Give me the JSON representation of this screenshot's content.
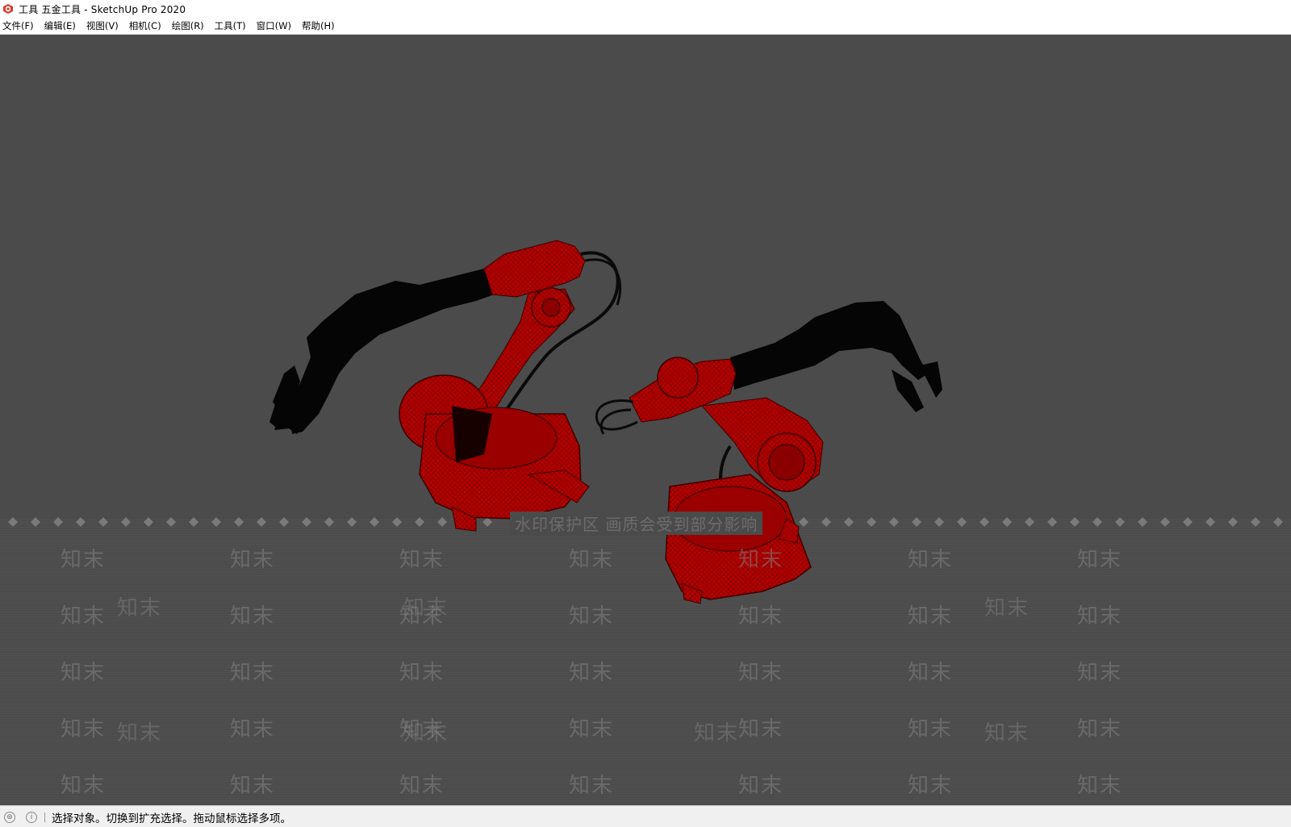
{
  "window": {
    "title": "工具 五金工具 - SketchUp Pro 2020",
    "app_icon": "sketchup-logo-icon"
  },
  "menubar": {
    "items": [
      {
        "label": "文件(F)"
      },
      {
        "label": "编辑(E)"
      },
      {
        "label": "视图(V)"
      },
      {
        "label": "相机(C)"
      },
      {
        "label": "绘图(R)"
      },
      {
        "label": "工具(T)"
      },
      {
        "label": "窗口(W)"
      },
      {
        "label": "帮助(H)"
      }
    ]
  },
  "viewport": {
    "background_color": "#4b4b4b",
    "model_color": "#b40000",
    "arm_color": "#050505",
    "watermark_notice": "水印保护区   画质会受到部分影响",
    "watermark_text": "知末"
  },
  "statusbar": {
    "geo_icon": "geo-location-icon",
    "info_icon": "info-icon",
    "message": "选择对象。切换到扩充选择。拖动鼠标选择多项。"
  }
}
